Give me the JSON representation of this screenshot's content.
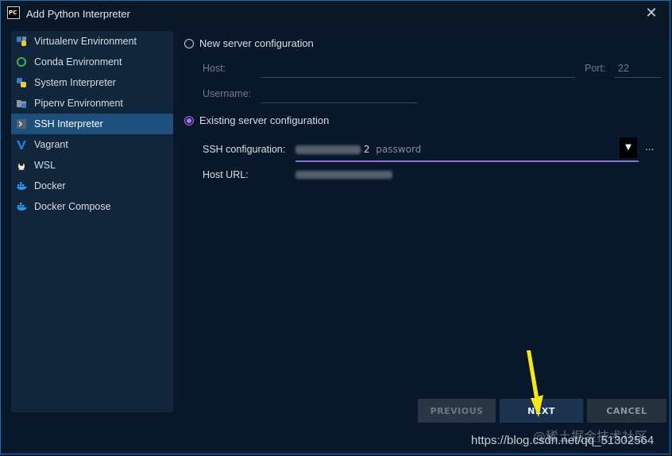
{
  "window": {
    "title": "Add Python Interpreter",
    "app_logo": "PC",
    "close_glyph": "✕"
  },
  "sidebar": {
    "items": [
      {
        "label": "Virtualenv Environment",
        "icon": "virtualenv-icon"
      },
      {
        "label": "Conda Environment",
        "icon": "conda-icon"
      },
      {
        "label": "System Interpreter",
        "icon": "python-icon"
      },
      {
        "label": "Pipenv Environment",
        "icon": "pipenv-icon"
      },
      {
        "label": "SSH Interpreter",
        "icon": "ssh-icon",
        "selected": true
      },
      {
        "label": "Vagrant",
        "icon": "vagrant-icon"
      },
      {
        "label": "WSL",
        "icon": "linux-icon"
      },
      {
        "label": "Docker",
        "icon": "docker-icon"
      },
      {
        "label": "Docker Compose",
        "icon": "docker-compose-icon"
      }
    ]
  },
  "main": {
    "new_server_label": "New server configuration",
    "host_label": "Host:",
    "port_label": "Port:",
    "port_value": "22",
    "username_label": "Username:",
    "existing_server_label": "Existing server configuration",
    "ssh_config_label": "SSH configuration:",
    "ssh_config_visible_digit": "2",
    "ssh_config_suffix": "password",
    "more_label": "...",
    "host_url_label": "Host URL:",
    "dropdown_glyph": "▼"
  },
  "buttons": {
    "previous": "PREVIOUS",
    "next": "NEXT",
    "cancel": "CANCEL"
  },
  "watermark": {
    "url": "https://blog.csdn.net/qq_51302564",
    "brand": "@稀土掘金技术社区"
  },
  "colors": {
    "accent": "#8e6fd9",
    "selection": "#1c4f7c",
    "arrow": "#f5e61a"
  }
}
